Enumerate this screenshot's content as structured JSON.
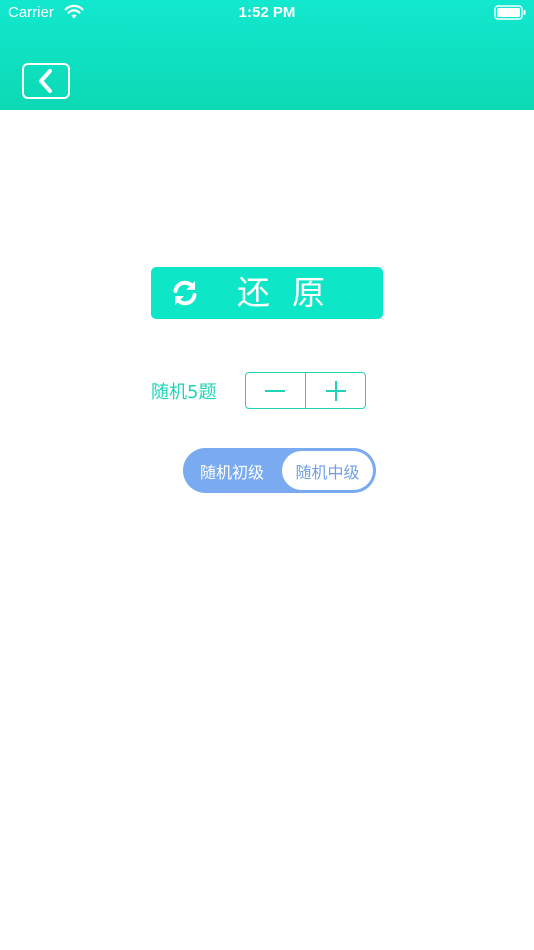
{
  "status_bar": {
    "carrier": "Carrier",
    "time": "1:52 PM",
    "wifi_icon": "wifi-icon",
    "battery_icon": "battery-icon"
  },
  "header": {
    "back_icon": "chevron-left-icon",
    "gradient_top": "#12e8cf",
    "gradient_bottom": "#0cd9b4"
  },
  "restore": {
    "icon": "refresh-icon",
    "label": "还原",
    "color": "#0de6c7"
  },
  "question_count": {
    "label": "随机5题",
    "minus_icon": "minus-icon",
    "plus_icon": "plus-icon",
    "color": "#1fd4b6"
  },
  "level_selector": {
    "options": [
      "随机初级",
      "随机中级"
    ],
    "selected_index": 1,
    "track_color": "#7aaaf0"
  }
}
